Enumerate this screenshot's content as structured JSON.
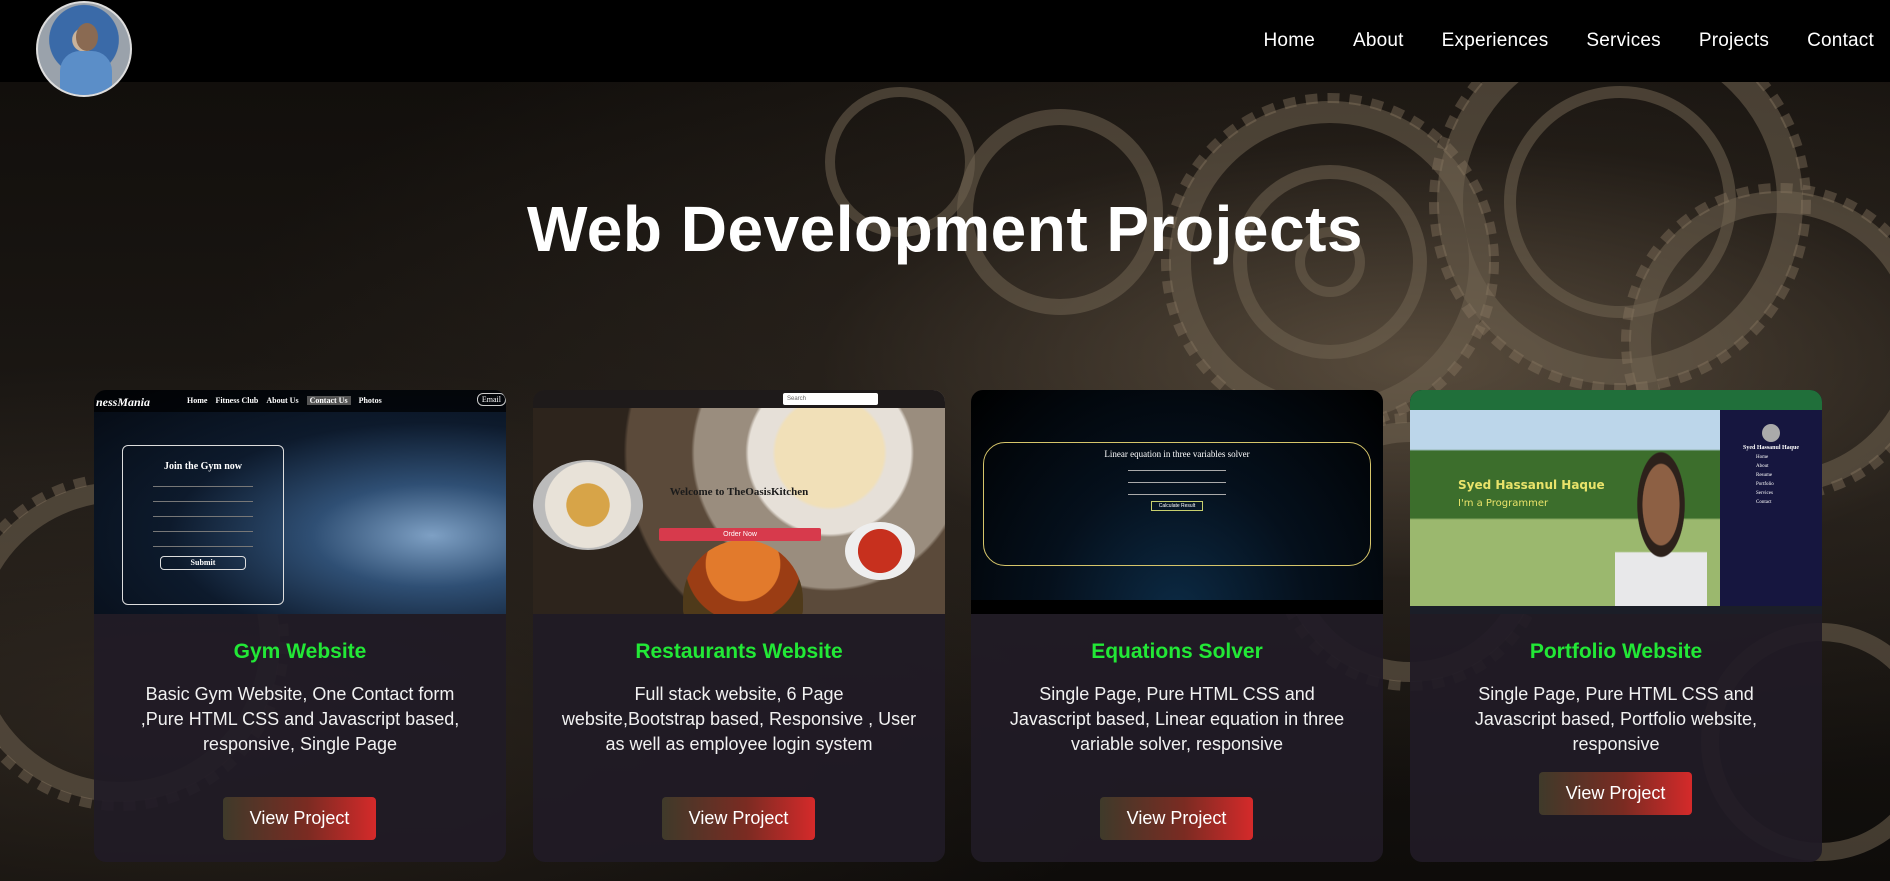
{
  "header": {
    "avatar_alt": "Profile photo",
    "nav": [
      "Home",
      "About",
      "Experiences",
      "Services",
      "Projects",
      "Contact"
    ]
  },
  "page_title": "Web Development Projects",
  "colors": {
    "project_title": "#22e836",
    "button_gradient_start": "#3f3a2a",
    "button_gradient_end": "#d52a2a",
    "card_bg": "#201b26"
  },
  "projects": [
    {
      "title": "Gym Website",
      "description": "Basic Gym Website, One Contact form ,Pure HTML CSS and Javascript based, responsive, Single Page",
      "button": "View Project",
      "thumb": {
        "brand": "nessMania",
        "links": [
          "Home",
          "Fitness Club",
          "About Us",
          "Contact Us",
          "Photos"
        ],
        "email": "Email",
        "form_title": "Join the Gym now",
        "submit": "Submit"
      }
    },
    {
      "title": "Restaurants Website",
      "description": "Full stack website, 6 Page website,Bootstrap based, Responsive , User as well as employee login system",
      "button": "View Project",
      "thumb": {
        "welcome": "Welcome to TheOasisKitchen",
        "order": "Order Now",
        "search": "Search"
      }
    },
    {
      "title": "Equations Solver",
      "description": "Single Page, Pure HTML CSS and Javascript based, Linear equation in three variable solver, responsive",
      "button": "View Project",
      "thumb": {
        "heading": "Linear equation in three variables solver",
        "calc": "Calculate Result"
      }
    },
    {
      "title": "Portfolio Website",
      "description": "Single Page, Pure HTML CSS and Javascript based, Portfolio website, responsive",
      "button": "View Project",
      "thumb": {
        "name": "Syed Hassanul Haque",
        "tagline": "I'm a Programmer",
        "side_name": "Syed Hassanul Haque",
        "side_menu": [
          "Home",
          "About",
          "Resume",
          "Portfolio",
          "Services",
          "Contact"
        ]
      }
    }
  ]
}
